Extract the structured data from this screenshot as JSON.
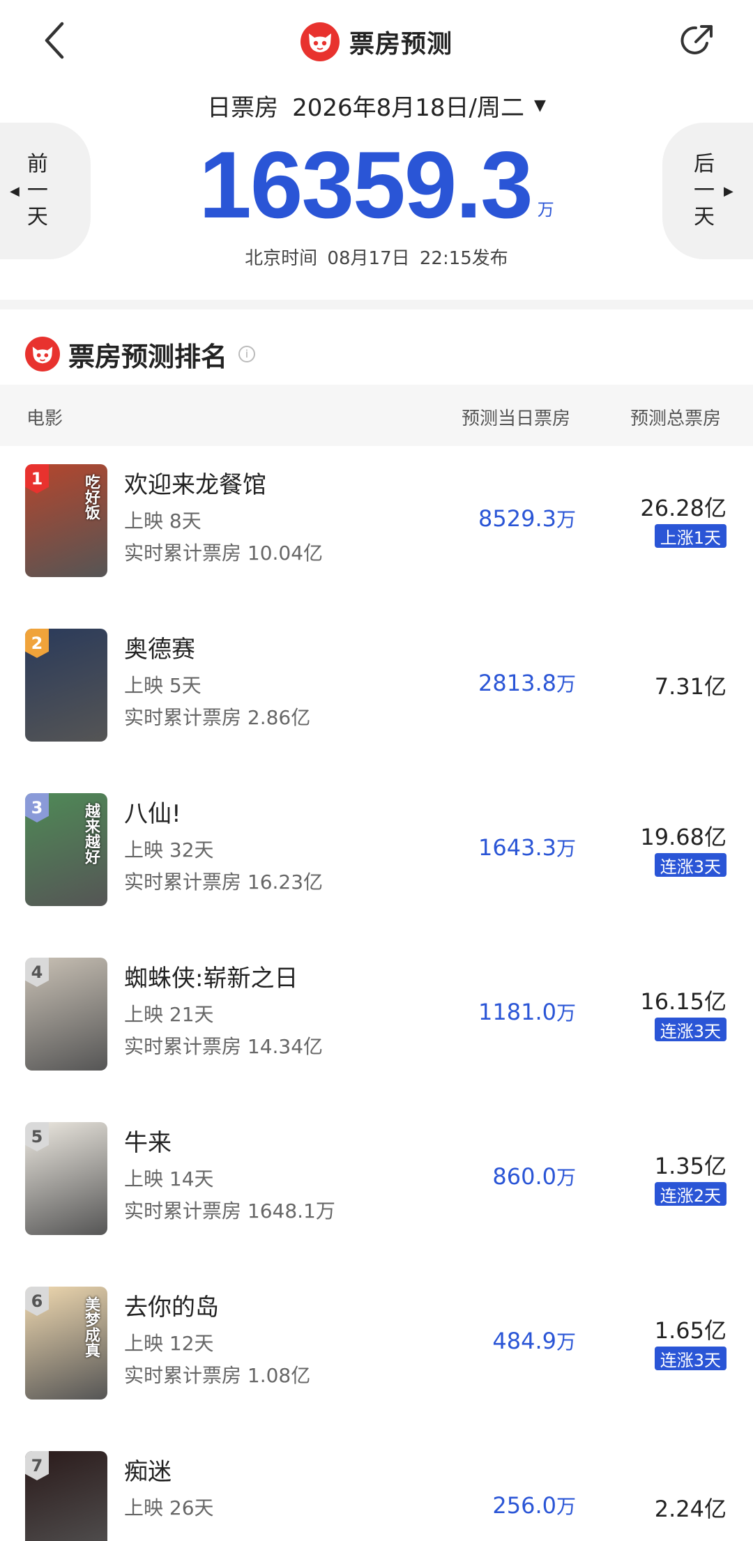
{
  "header": {
    "title": "票房预测",
    "date_label": "日票房",
    "date_value": "2026年8月18日/周二",
    "prev_day": "前一天",
    "next_day": "后一天",
    "total_value": "16359.3",
    "total_unit": "万",
    "published": "北京时间 08月17日 22:15发布"
  },
  "ranking": {
    "title": "票房预测排名",
    "info": "i",
    "columns": [
      "电影",
      "预测当日票房",
      "预测总票房"
    ]
  },
  "movies": [
    {
      "rank": "1",
      "name": "欢迎来龙餐馆",
      "days": "上映 8天",
      "cumulative": "实时累计票房 10.04亿",
      "daily": "8529.3",
      "daily_unit": "万",
      "total": "26.28亿",
      "tag": "上涨1天",
      "poster_text": "吃好饭"
    },
    {
      "rank": "2",
      "name": "奥德赛",
      "days": "上映 5天",
      "cumulative": "实时累计票房 2.86亿",
      "daily": "2813.8",
      "daily_unit": "万",
      "total": "7.31亿",
      "tag": "",
      "poster_text": ""
    },
    {
      "rank": "3",
      "name": "八仙!",
      "days": "上映 32天",
      "cumulative": "实时累计票房 16.23亿",
      "daily": "1643.3",
      "daily_unit": "万",
      "total": "19.68亿",
      "tag": "连涨3天",
      "poster_text": "越来越好"
    },
    {
      "rank": "4",
      "name": "蜘蛛侠:崭新之日",
      "days": "上映 21天",
      "cumulative": "实时累计票房 14.34亿",
      "daily": "1181.0",
      "daily_unit": "万",
      "total": "16.15亿",
      "tag": "连涨3天",
      "poster_text": ""
    },
    {
      "rank": "5",
      "name": "牛来",
      "days": "上映 14天",
      "cumulative": "实时累计票房 1648.1万",
      "daily": "860.0",
      "daily_unit": "万",
      "total": "1.35亿",
      "tag": "连涨2天",
      "poster_text": ""
    },
    {
      "rank": "6",
      "name": "去你的岛",
      "days": "上映 12天",
      "cumulative": "实时累计票房 1.08亿",
      "daily": "484.9",
      "daily_unit": "万",
      "total": "1.65亿",
      "tag": "连涨3天",
      "poster_text": "美梦成真"
    },
    {
      "rank": "7",
      "name": "痴迷",
      "days": "上映 26天",
      "cumulative": "",
      "daily": "256.0",
      "daily_unit": "万",
      "total": "2.24亿",
      "tag": "",
      "poster_text": ""
    }
  ],
  "colors": {
    "accent": "#2a55d6",
    "brand": "#e8322e",
    "rank_colors": [
      "#e8322e",
      "#f0a33a",
      "#8a9ad8",
      "#d9d9d9",
      "#d9d9d9",
      "#d9d9d9",
      "#d9d9d9"
    ],
    "poster_colors": [
      "#b5462d",
      "#2a3a5a",
      "#4f8a57",
      "#c9c1b5",
      "#ece8e0",
      "#f0d9b0",
      "#2a1a1a"
    ]
  },
  "icons": {
    "back": "chevron-left-icon",
    "share": "share-icon",
    "logo": "cat-logo-icon"
  }
}
